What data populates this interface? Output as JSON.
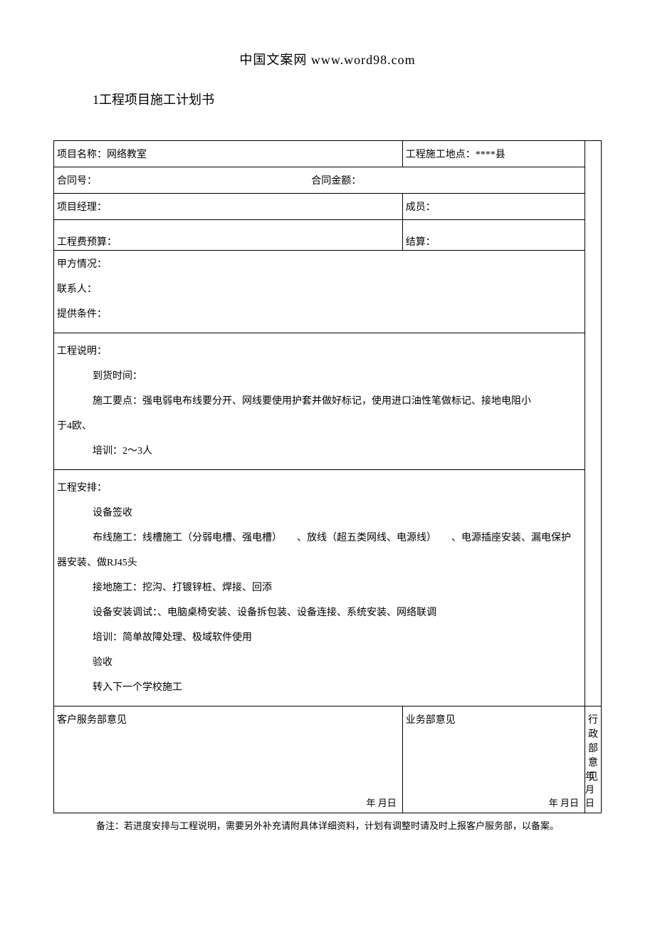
{
  "header": "中国文案网 www.word98.com",
  "title": "1工程项目施工计划书",
  "row1": {
    "projectNameLabel": "项目名称：网络教室",
    "locationLabel": "工程施工地点：****县"
  },
  "row2": {
    "contractNoLabel": "合同号：",
    "contractAmountLabel": "合同金额："
  },
  "row3": {
    "pmLabel": "项目经理：",
    "memberLabel": "成员："
  },
  "row4": {
    "budgetLabel": "工程费预算：",
    "settlementLabel": "结算："
  },
  "row5": {
    "partyALabel": "甲方情况：",
    "contactLabel": "联系人：",
    "conditionLabel": "提供条件："
  },
  "row6": {
    "descLabel": "工程说明：",
    "arrivalLabel": "到货时间：",
    "pointsLabel": "施工要点：强电弱电布线要分开、网线要使用护套并做好标记，使用进口油性笔做标记、接地电阻小",
    "ohmLabel": "于4欧、",
    "trainingLabel": "培训：2～3人"
  },
  "row7": {
    "arrangeLabel": "工程安排：",
    "signLabel": "设备签收",
    "wiringLabel1": "布线施工：线槽施工（分弱电槽、强电槽）",
    "wiringLabel2": "、放线（超五类网线、电源线）",
    "wiringLabel3": "、电源插座安装、漏电保护",
    "rj45Label": "器安装、做RJ45头",
    "groundingLabel": "接地施工：挖沟、打镀锌桩、焊接、回添",
    "debugLabel": "设备安装调试：、电脑桌椅安装、设备拆包装、设备连接、系统安装、网络联调",
    "trainLabel": "培训：简单故障处理、极域软件使用",
    "acceptLabel": "验收",
    "nextLabel": "转入下一个学校施工"
  },
  "row8": {
    "customerLabel": "客户服务部意见",
    "businessLabel": "业务部意见",
    "adminLabel": "行政部意见",
    "dateLabel": "年 月日"
  },
  "footnote": "备注：若进度安排与工程说明，需要另外补充请附具体详细资料，计划有调整时请及时上报客户服务部，以备案。"
}
